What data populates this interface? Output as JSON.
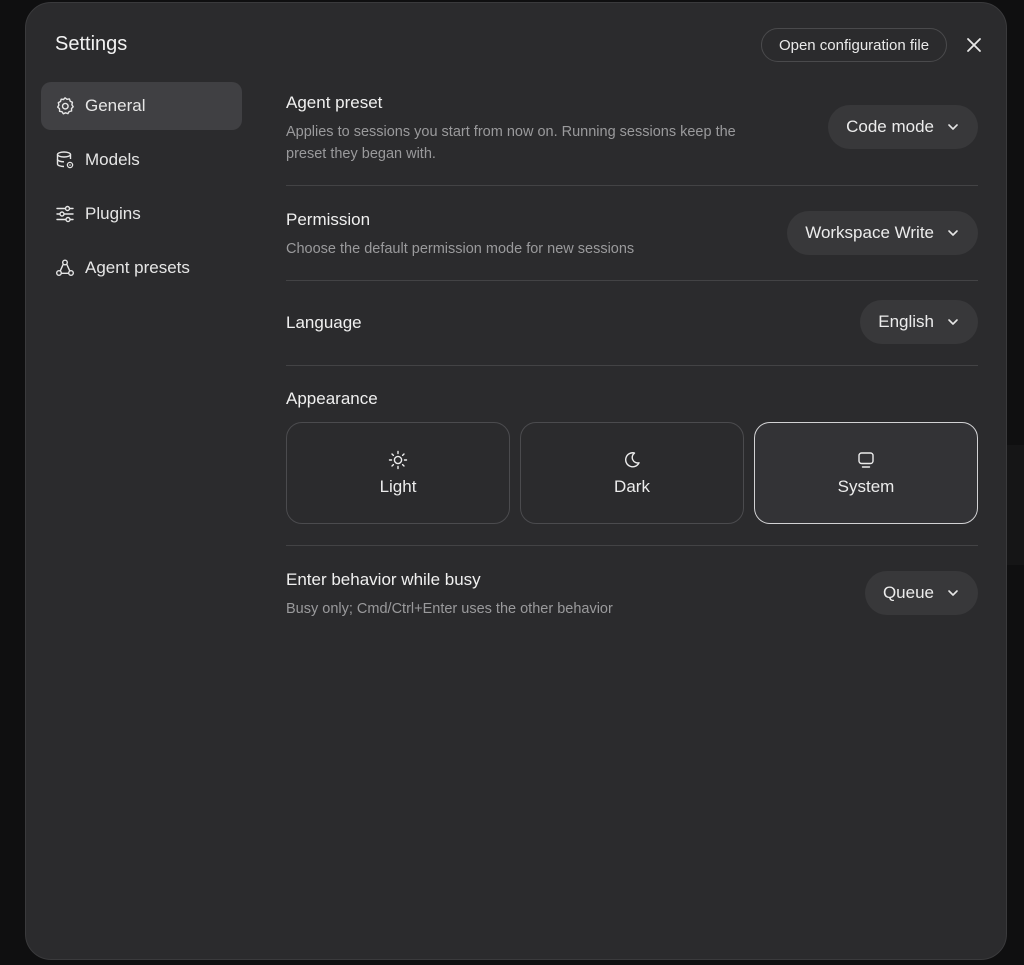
{
  "settings": {
    "title": "Settings",
    "open_config_label": "Open configuration file",
    "close_icon": "close-icon"
  },
  "sidebar": {
    "items": [
      {
        "label": "General",
        "icon": "gear-icon",
        "active": true
      },
      {
        "label": "Models",
        "icon": "database-gear-icon",
        "active": false
      },
      {
        "label": "Plugins",
        "icon": "sliders-icon",
        "active": false
      },
      {
        "label": "Agent presets",
        "icon": "agents-icon",
        "active": false
      }
    ]
  },
  "general": {
    "agent_preset": {
      "title": "Agent preset",
      "description": "Applies to sessions you start from now on. Running sessions keep the preset they began with.",
      "value": "Code mode"
    },
    "permission": {
      "title": "Permission",
      "description": "Choose the default permission mode for new sessions",
      "value": "Workspace Write"
    },
    "language": {
      "title": "Language",
      "value": "English"
    },
    "appearance": {
      "title": "Appearance",
      "options": [
        {
          "label": "Light",
          "icon": "sun-icon",
          "selected": false
        },
        {
          "label": "Dark",
          "icon": "moon-icon",
          "selected": false
        },
        {
          "label": "System",
          "icon": "monitor-icon",
          "selected": true
        }
      ]
    },
    "enter_behavior": {
      "title": "Enter behavior while busy",
      "description": "Busy only; Cmd/Ctrl+Enter uses the other behavior",
      "value": "Queue"
    }
  },
  "colors": {
    "modal_bg": "#2b2b2d",
    "active_item_bg": "#404043",
    "dropdown_bg": "#38383a",
    "selected_border": "#d2d2d4"
  }
}
